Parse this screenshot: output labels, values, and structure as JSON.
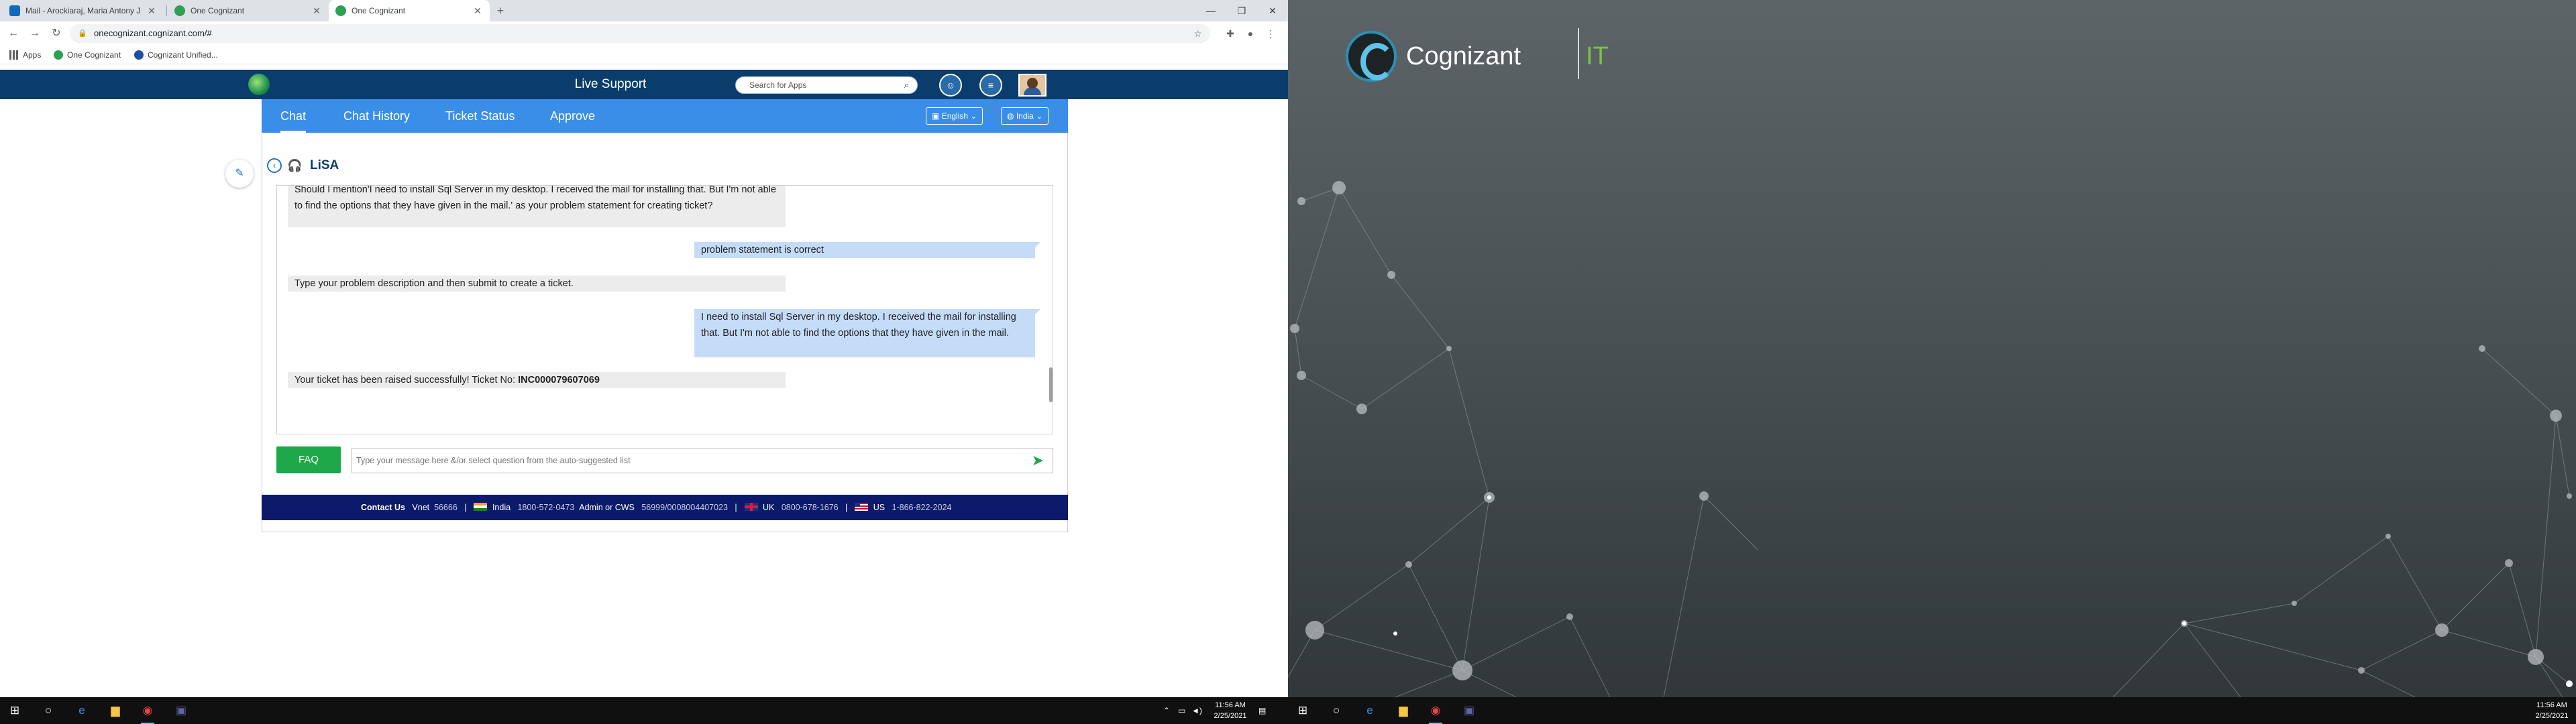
{
  "browser": {
    "tabs": [
      {
        "title": "Mail - Arockiaraj, Maria Antony J",
        "active": false
      },
      {
        "title": "One Cognizant",
        "active": false
      },
      {
        "title": "One Cognizant",
        "active": true
      }
    ],
    "url": "onecognizant.cognizant.com/#",
    "bookmarks": [
      "Apps",
      "One Cognizant",
      "Cognizant Unified..."
    ]
  },
  "app": {
    "title": "Live Support",
    "search_placeholder": "Search for Apps",
    "nav": {
      "items": [
        "Chat",
        "Chat History",
        "Ticket Status",
        "Approve"
      ],
      "active": "Chat",
      "language": "English",
      "region": "India"
    },
    "bot_name": "LiSA",
    "messages": [
      {
        "from": "bot",
        "text": "Should I mention'I need to install Sql Server in my desktop. I received the mail for installing that. But I'm not able to find the options that they have given in the mail.' as your problem statement for creating ticket?"
      },
      {
        "from": "user",
        "text": "problem statement is correct"
      },
      {
        "from": "bot",
        "text": "Type your problem description and then submit to create a ticket."
      },
      {
        "from": "user",
        "text": "I need to install Sql Server in my desktop. I received the mail for installing that. But I'm not able to find the options that they have given in the mail."
      },
      {
        "from": "bot",
        "text": "Your ticket has been raised successfully! Ticket No:",
        "ticket": "INC000079607069"
      }
    ],
    "faq_label": "FAQ",
    "input_placeholder": "Type your message here &/or select question from the auto-suggested list",
    "contact": {
      "label": "Contact Us",
      "vnet_label": "Vnet",
      "vnet": "56666",
      "india_label": "India",
      "india": "1800-572-0473",
      "admin_label": "Admin or CWS",
      "admin": "56999/0008004407023",
      "uk_label": "UK",
      "uk": "0800-678-1676",
      "us_label": "US",
      "us": "1-866-822-2024"
    }
  },
  "taskbar": {
    "time": "11:56 AM",
    "date": "2/25/2021"
  },
  "wallpaper": {
    "brand": "Cognizant",
    "brand_suffix": "IT"
  },
  "colors": {
    "header": "#0a3d6b",
    "nav": "#3a8ee8",
    "faq": "#1ea84a",
    "contact_bar": "#0b1a6a",
    "user_bubble": "#c4dcf8"
  }
}
